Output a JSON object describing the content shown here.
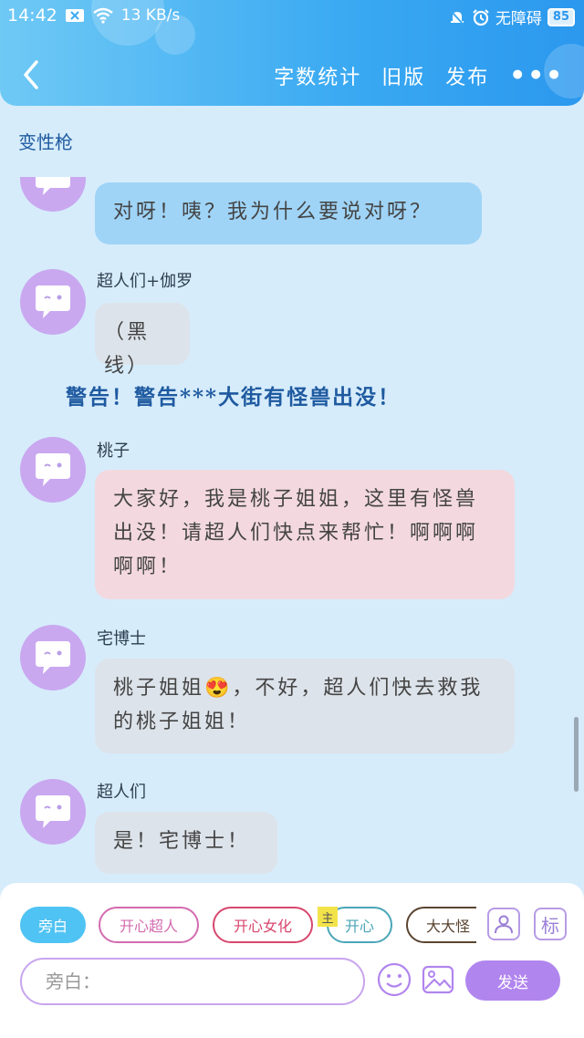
{
  "status_bar": {
    "time": "14:42",
    "network_speed": "13 KB/s",
    "accessibility": "无障碍",
    "battery": "85"
  },
  "nav": {
    "word_count": "字数统计",
    "old_version": "旧版",
    "publish": "发布",
    "more": "•••"
  },
  "story_title": "变性枪",
  "messages": [
    {
      "speaker": "",
      "text": "对呀！咦？我为什么要说对呀？",
      "style": "blue"
    },
    {
      "speaker": "超人们+伽罗",
      "text": "（黑线）",
      "style": "gray"
    },
    {
      "speaker": "桃子",
      "text": "大家好，我是桃子姐姐，这里有怪兽出没！请超人们快点来帮忙！啊啊啊啊啊！",
      "style": "pink"
    },
    {
      "speaker": "宅博士",
      "text_before_emoji": "桃子姐姐",
      "emoji": "😍",
      "text_after_emoji": "，不好，超人们快去救我的桃子姐姐！",
      "style": "gray"
    },
    {
      "speaker": "超人们",
      "text": "是！宅博士！",
      "style": "gray"
    }
  ],
  "narration": "警告！警告***大街有怪兽出没！",
  "roles": [
    {
      "label": "旁白",
      "active": true,
      "color": "#4fc3f3"
    },
    {
      "label": "开心超人",
      "active": false,
      "color": "#d36bb0"
    },
    {
      "label": "开心女化",
      "active": false,
      "color": "#d8476e"
    },
    {
      "label": "开心",
      "active": false,
      "color": "#4aa6b8"
    },
    {
      "label": "大大怪",
      "active": false,
      "color": "#5a4430"
    }
  ],
  "host_tag": "主",
  "tools": {
    "label_button": "标"
  },
  "input": {
    "placeholder": "旁白："
  },
  "send_label": "发送",
  "colors": {
    "accent": "#2b98ee",
    "send": "#b185ee"
  }
}
